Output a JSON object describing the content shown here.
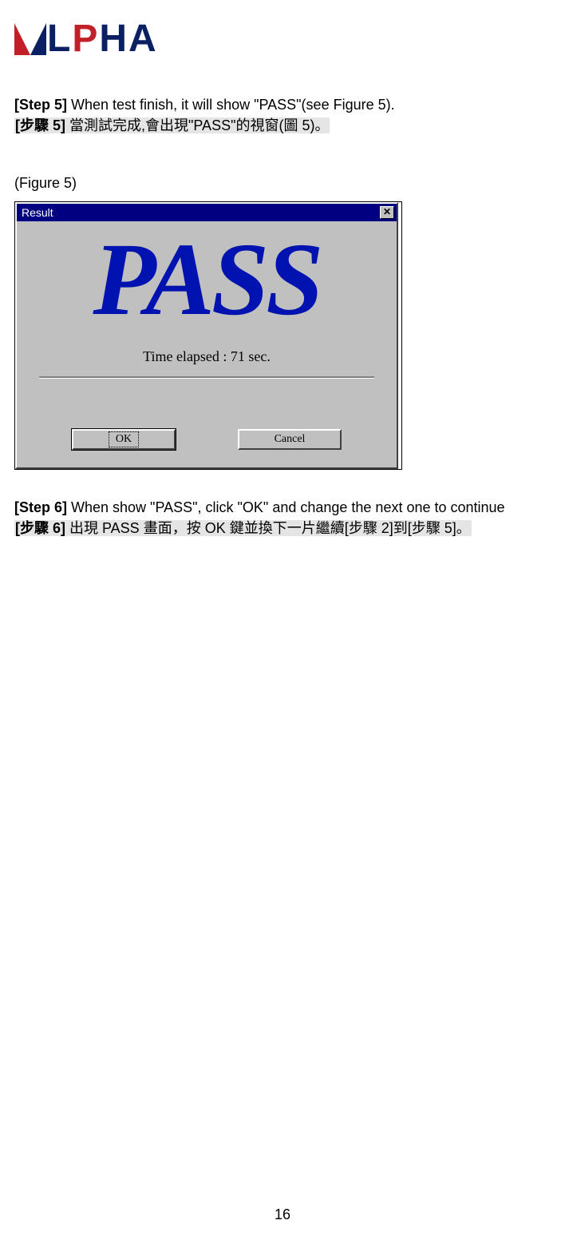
{
  "logo": {
    "brand": "ALPHA"
  },
  "step5": {
    "en_lead": "[Step 5]",
    "en_rest": " When test finish, it will show \"PASS\"(see Figure 5).",
    "zh_lead": "[步驟 5]",
    "zh_rest": "  當測試完成,會出現\"PASS\"的視窗(圖 5)。"
  },
  "figure_label": "(Figure 5)",
  "dialog": {
    "title": "Result",
    "pass_text": "PASS",
    "elapsed": "Time elapsed : 71 sec.",
    "ok_label": "OK",
    "cancel_label": "Cancel",
    "close_glyph": "✕"
  },
  "step6": {
    "en_lead": "[Step 6]",
    "en_rest": " When show \"PASS\", click \"OK\" and change the next one to continue",
    "zh_lead": "[步驟 6]",
    "zh_rest": "  出現 PASS 畫面，按 OK 鍵並換下一片繼續[步驟 2]到[步驟 5]。"
  },
  "page_number": "16"
}
